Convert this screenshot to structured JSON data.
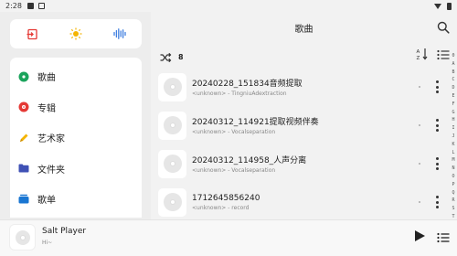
{
  "status": {
    "time": "2:28"
  },
  "sidebar": {
    "top_icons": [
      "exit-icon",
      "sun-icon",
      "equalizer-icon"
    ],
    "items": [
      {
        "label": "歌曲",
        "icon": "disc-icon",
        "color": "#1aa35b"
      },
      {
        "label": "专辑",
        "icon": "album-icon",
        "color": "#e53935"
      },
      {
        "label": "艺术家",
        "icon": "pencil-icon",
        "color": "#f4b400"
      },
      {
        "label": "文件夹",
        "icon": "folder-icon",
        "color": "#3f51b5"
      },
      {
        "label": "歌单",
        "icon": "playlist-icon",
        "color": "#1976d2"
      }
    ]
  },
  "main": {
    "title": "歌曲",
    "song_count": "8",
    "index_letters": [
      "0",
      "A",
      "B",
      "C",
      "D",
      "E",
      "F",
      "G",
      "H",
      "I",
      "J",
      "K",
      "L",
      "M",
      "N",
      "O",
      "P",
      "Q",
      "R",
      "S",
      "T"
    ]
  },
  "songs": [
    {
      "title": "20240228_151834音频提取",
      "subtitle": "<unknown> - TingniuAdextraction"
    },
    {
      "title": "20240312_114921提取视频伴奏",
      "subtitle": "<unknown> - Vocalseparation"
    },
    {
      "title": "20240312_114958_人声分离",
      "subtitle": "<unknown> - Vocalseparation"
    },
    {
      "title": "1712645856240",
      "subtitle": "<unknown> - record"
    }
  ],
  "player": {
    "title": "Salt Player",
    "subtitle": "Hi~"
  }
}
